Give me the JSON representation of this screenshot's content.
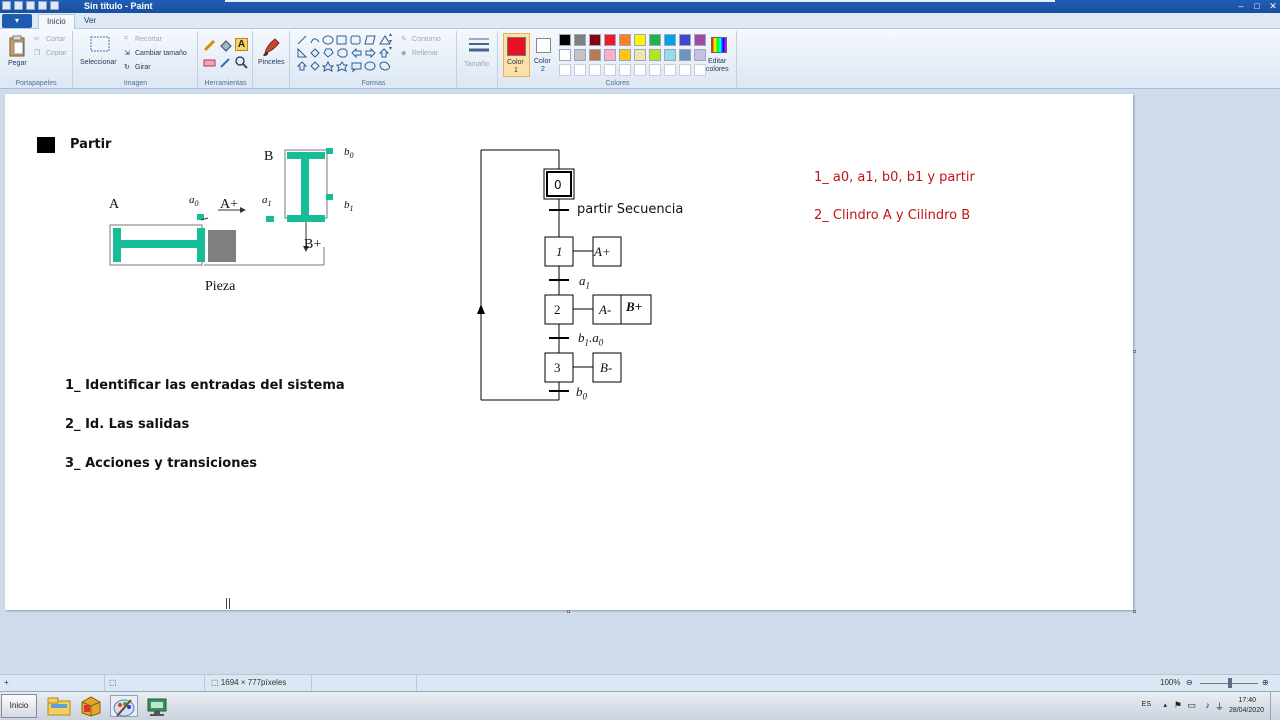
{
  "window": {
    "title": "Sin título - Paint"
  },
  "tabs": {
    "app_menu": "▾",
    "inicio": "Inicio",
    "ver": "Ver"
  },
  "ribbon": {
    "portapapeles": {
      "label": "Portapapeles",
      "pegar": "Pegar",
      "cortar": "Cortar",
      "copiar": "Copiar"
    },
    "imagen": {
      "label": "Imagen",
      "seleccionar": "Seleccionar",
      "recortar": "Recortar",
      "cambiar_tamano": "Cambiar tamaño",
      "girar": "Girar"
    },
    "herramientas": {
      "label": "Herramientas"
    },
    "pinceles": {
      "label": "Pinceles"
    },
    "formas": {
      "label": "Formas",
      "contorno": "Contorno",
      "rellenar": "Rellenar"
    },
    "tamano": {
      "label": "Tamaño"
    },
    "colores": {
      "label": "Colores",
      "color1_label": "Color",
      "color1_num": "1",
      "color2_label": "Color",
      "color2_num": "2",
      "editar_label": "Editar",
      "editar_label2": "colores",
      "color1": "#e81123",
      "color2": "#ffffff",
      "palette_row1": [
        "#000000",
        "#7f7f7f",
        "#880015",
        "#ed1c24",
        "#ff7f27",
        "#fff200",
        "#22b14c",
        "#00a2e8",
        "#3f48cc",
        "#a349a4"
      ],
      "palette_row2": [
        "#ffffff",
        "#c3c3c3",
        "#b97a57",
        "#ffaec9",
        "#ffc90e",
        "#efe4b0",
        "#b5e61d",
        "#99d9ea",
        "#7092be",
        "#c8bfe7"
      ]
    }
  },
  "canvas": {
    "partir_label": "Partir",
    "steps": [
      "1_ Identificar las entradas del sistema",
      "2_ Id. Las salidas",
      "3_ Acciones y transiciones"
    ],
    "notes": [
      "1_ a0, a1, b0, b1 y partir",
      "2_ Clindro A y Cilindro B"
    ],
    "diagram": {
      "label_A": "A",
      "label_B": "B",
      "label_a0": "a",
      "label_a0_sub": "0",
      "label_a1": "a",
      "label_a1_sub": "1",
      "label_b0": "b",
      "label_b0_sub": "0",
      "label_b1": "b",
      "label_b1_sub": "1",
      "label_Aplus": "A+",
      "label_Bplus": "B+",
      "label_pieza": "Pieza"
    },
    "grafcet": {
      "step0": "0",
      "step1": "1",
      "step2": "2",
      "step3": "3",
      "trans0": "partir Secuencia",
      "trans1": "a",
      "trans1_sub": "1",
      "trans2a": "b",
      "trans2a_sub": "1",
      "trans2_dot": ".a",
      "trans2b_sub": "0",
      "trans3": "b",
      "trans3_sub": "0",
      "action1": "A+",
      "action2a": "A-",
      "action2b": "B+",
      "action3": "B-"
    }
  },
  "statusbar": {
    "size": "1694 × 777píxeles",
    "zoom": "100%"
  },
  "taskbar": {
    "start": "Inicio",
    "lang": "ES",
    "time": "17:40",
    "date": "28/04/2020"
  }
}
